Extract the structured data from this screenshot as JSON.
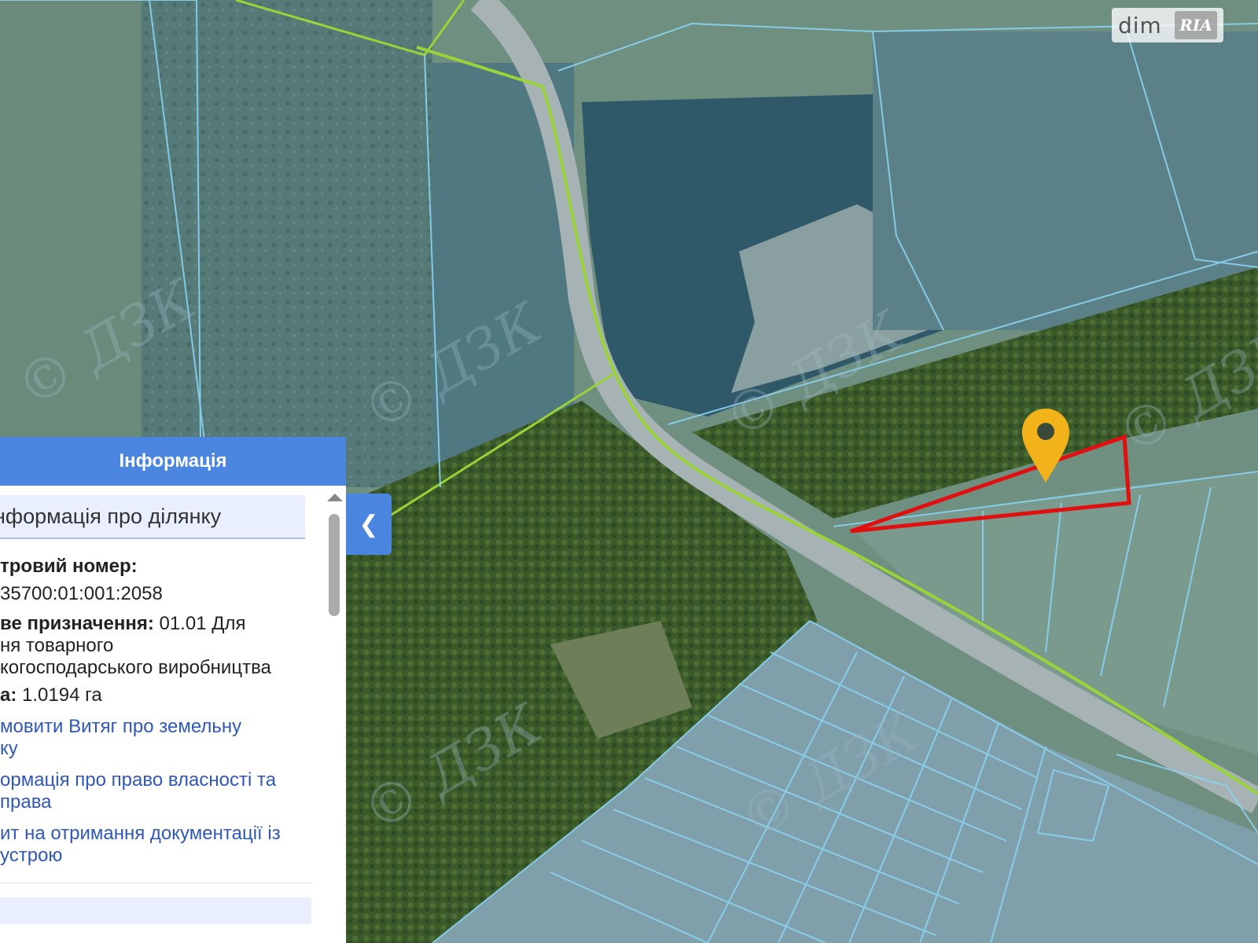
{
  "watermark": {
    "brand": "dim",
    "badge": "RIA"
  },
  "panel": {
    "title": "Інформація",
    "section_title": "нформація про ділянку",
    "cadastral_label": "тровий номер:",
    "cadastral_value": "35700:01:001:2058",
    "purpose_label": "ве призначення:",
    "purpose_value_1": "01.01 Для",
    "purpose_value_2": "ня товарного",
    "purpose_value_3": "когосподарського виробництва",
    "area_label": "а:",
    "area_value": "1.0194 га",
    "links": [
      {
        "line1": "мовити Витяг про земельну",
        "line2": "ку"
      },
      {
        "line1": "ормація про право власності та",
        "line2": "права"
      },
      {
        "line1": "ит на отримання документації із",
        "line2": "устрою"
      }
    ],
    "next_section": "               "
  },
  "map": {
    "watermark_text": "© ДЗК",
    "highlight_color": "#e01010",
    "marker_color": "#f2b21a",
    "parcel_color": "#8ad3f2",
    "road_color": "#9ad23a"
  }
}
